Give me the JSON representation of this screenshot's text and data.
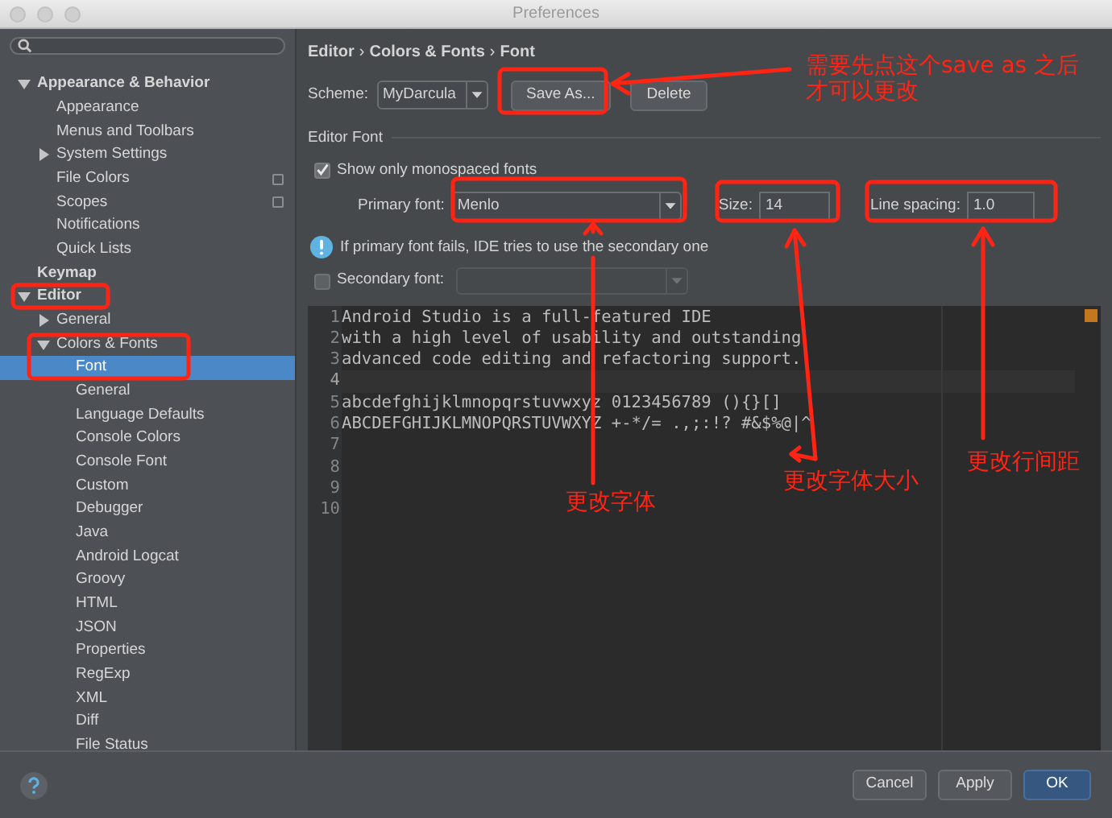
{
  "window": {
    "title": "Preferences"
  },
  "sidebar": {
    "items": [
      {
        "label": "Appearance & Behavior",
        "expanded": true,
        "selected": false,
        "children": [
          {
            "label": "Appearance",
            "selected": false
          },
          {
            "label": "Menus and Toolbars",
            "selected": false
          },
          {
            "label": "System Settings",
            "expanded": false,
            "selected": false
          },
          {
            "label": "File Colors",
            "selected": false,
            "icon": true
          },
          {
            "label": "Scopes",
            "selected": false,
            "icon": true
          },
          {
            "label": "Notifications",
            "selected": false
          },
          {
            "label": "Quick Lists",
            "selected": false
          }
        ]
      },
      {
        "label": "Keymap",
        "selected": false
      },
      {
        "label": "Editor",
        "expanded": true,
        "selected": false,
        "children": [
          {
            "label": "General",
            "expanded": false,
            "selected": false
          },
          {
            "label": "Colors & Fonts",
            "expanded": true,
            "selected": false,
            "children": [
              {
                "label": "Font",
                "selected": true
              },
              {
                "label": "General",
                "selected": false
              },
              {
                "label": "Language Defaults",
                "selected": false
              },
              {
                "label": "Console Colors",
                "selected": false
              },
              {
                "label": "Console Font",
                "selected": false
              },
              {
                "label": "Custom",
                "selected": false
              },
              {
                "label": "Debugger",
                "selected": false
              },
              {
                "label": "Java",
                "selected": false
              },
              {
                "label": "Android Logcat",
                "selected": false
              },
              {
                "label": "Groovy",
                "selected": false
              },
              {
                "label": "HTML",
                "selected": false
              },
              {
                "label": "JSON",
                "selected": false
              },
              {
                "label": "Properties",
                "selected": false
              },
              {
                "label": "RegExp",
                "selected": false
              },
              {
                "label": "XML",
                "selected": false
              },
              {
                "label": "Diff",
                "selected": false
              },
              {
                "label": "File Status",
                "selected": false
              }
            ]
          }
        ]
      }
    ]
  },
  "breadcrumb": {
    "parts": [
      "Editor",
      "Colors & Fonts",
      "Font"
    ],
    "separator": "›"
  },
  "scheme": {
    "label": "Scheme:",
    "value": "MyDarcula"
  },
  "scheme_buttons": [
    {
      "label": "Save As..."
    },
    {
      "label": "Delete"
    }
  ],
  "editor_font": {
    "title": "Editor Font",
    "monospaced_only": {
      "label": "Show only monospaced fonts",
      "checked": true
    },
    "primary_font": {
      "label": "Primary font:",
      "value": "Menlo"
    },
    "size": {
      "label": "Size:",
      "value": "14"
    },
    "line_spacing": {
      "label": "Line spacing:",
      "value": "1.0"
    },
    "info": "If primary font fails, IDE tries to use the secondary one",
    "secondary_font": {
      "label": "Secondary font:",
      "checked": false
    }
  },
  "preview": {
    "lines": [
      {
        "number": "1",
        "text": "Android Studio is a full-featured IDE",
        "current": false
      },
      {
        "number": "2",
        "text": "with a high level of usability and outstanding",
        "current": false
      },
      {
        "number": "3",
        "text": "advanced code editing and refactoring support.",
        "current": false
      },
      {
        "number": "4",
        "current": true
      },
      {
        "number": "5",
        "text": "abcdefghijklmnopqrstuvwxyz 0123456789 (){}[]",
        "current": false
      },
      {
        "number": "6",
        "text": "ABCDEFGHIJKLMNOPQRSTUVWXYZ +-*/= .,;:!? #&$%@|^",
        "current": false
      },
      {
        "number": "7",
        "current": false
      },
      {
        "number": "8",
        "current": false
      },
      {
        "number": "9",
        "current": false
      },
      {
        "number": "10",
        "current": false
      }
    ]
  },
  "footer": {
    "buttons": [
      {
        "label": "Cancel",
        "default": false
      },
      {
        "label": "Apply",
        "default": false
      },
      {
        "label": "OK",
        "default": true
      }
    ]
  },
  "annotations": [
    {
      "lines": [
        "需要先点这个save as 之后",
        "才可以更改"
      ]
    },
    {
      "lines": [
        "更改字体"
      ]
    },
    {
      "lines": [
        "更改字体大小"
      ]
    },
    {
      "lines": [
        "更改行间距"
      ]
    }
  ]
}
